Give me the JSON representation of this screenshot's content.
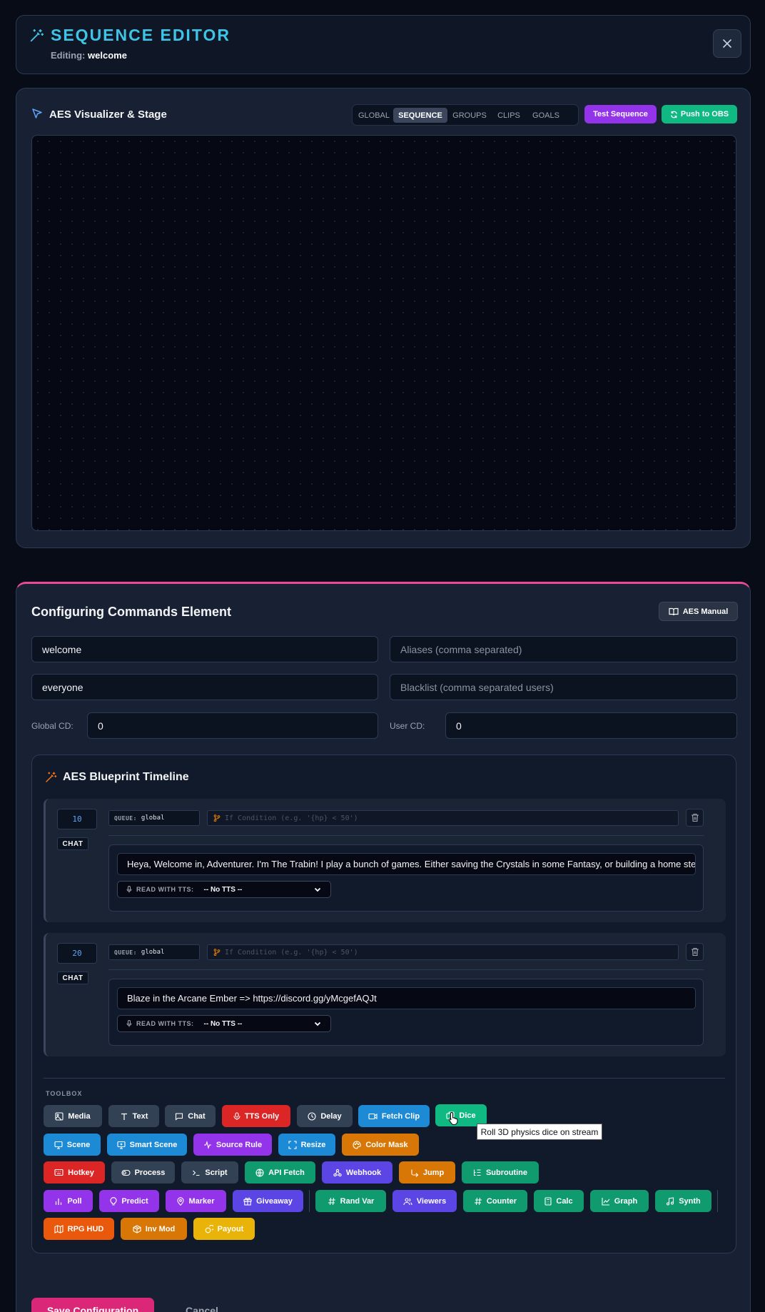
{
  "header": {
    "title": "SEQUENCE EDITOR",
    "editing_label": "Editing:",
    "editing_value": "welcome"
  },
  "visualizer": {
    "title": "AES Visualizer & Stage",
    "tabs": [
      "GLOBAL",
      "SEQUENCE",
      "GROUPS",
      "CLIPS",
      "GOALS"
    ],
    "active_tab": "SEQUENCE",
    "test_button": "Test Sequence",
    "push_button": "Push to OBS"
  },
  "config": {
    "title": "Configuring Commands Element",
    "manual_button": "AES Manual",
    "command_name": "welcome",
    "aliases_placeholder": "Aliases (comma separated)",
    "permission": "everyone",
    "blacklist_placeholder": "Blacklist (comma separated users)",
    "global_cd_label": "Global CD:",
    "global_cd_value": "0",
    "user_cd_label": "User CD:",
    "user_cd_value": "0"
  },
  "timeline": {
    "title": "AES Blueprint Timeline",
    "steps": [
      {
        "delay": "10",
        "type": "CHAT",
        "queue_label": "QUEUE:",
        "queue": "global",
        "condition_placeholder": "If Condition (e.g. '{hp} < 50')",
        "message": "Heya, Welcome in, Adventurer. I'm The Trabin! I play a bunch of games. Either saving the Crystals in some Fantasy, or building a home stead i",
        "tts_label": "READ WITH TTS:",
        "tts_value": "-- No TTS --"
      },
      {
        "delay": "20",
        "type": "CHAT",
        "queue_label": "QUEUE:",
        "queue": "global",
        "condition_placeholder": "If Condition (e.g. '{hp} < 50')",
        "message": "Blaze in the Arcane Ember => https://discord.gg/yMcgefAQJt",
        "tts_label": "READ WITH TTS:",
        "tts_value": "-- No TTS --"
      }
    ]
  },
  "toolbox": {
    "label": "TOOLBOX",
    "tools": [
      "Media",
      "Text",
      "Chat",
      "TTS Only",
      "Delay",
      "Fetch Clip",
      "Dice",
      "Scene",
      "Smart Scene",
      "Source Rule",
      "Resize",
      "Color Mask",
      "Hotkey",
      "Process",
      "Script",
      "API Fetch",
      "Webhook",
      "Jump",
      "Subroutine",
      "Poll",
      "Predict",
      "Marker",
      "Giveaway",
      "Rand Var",
      "Viewers",
      "Counter",
      "Calc",
      "Graph",
      "Synth",
      "RPG HUD",
      "Inv Mod",
      "Payout"
    ],
    "tooltip": "Roll 3D physics dice on stream"
  },
  "footer": {
    "save_button": "Save Configuration",
    "cancel_button": "Cancel"
  },
  "colors": {
    "accent_cyan": "#3ec4e6",
    "accent_pink": "#ec4899",
    "test_purple": "#9333ea",
    "push_green": "#10b981"
  }
}
